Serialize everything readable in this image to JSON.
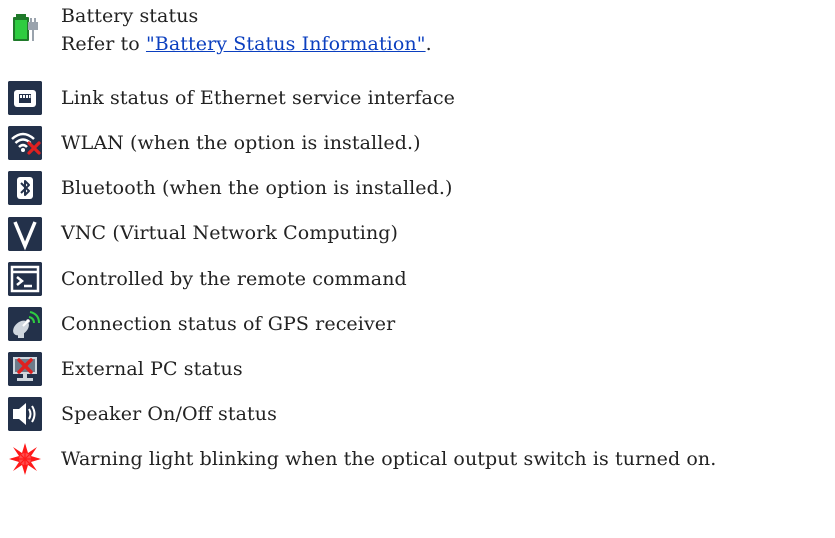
{
  "items": [
    {
      "icon": "battery-charging-icon",
      "label": "Battery status",
      "sub_prefix": "Refer to ",
      "link_text": "\"Battery Status Information\"",
      "sub_suffix": "."
    },
    {
      "icon": "ethernet-icon",
      "label": "Link status of Ethernet service interface"
    },
    {
      "icon": "wlan-disabled-icon",
      "label": "WLAN (when the option is installed.)"
    },
    {
      "icon": "bluetooth-icon",
      "label": "Bluetooth (when the option is installed.)"
    },
    {
      "icon": "vnc-icon",
      "label": "VNC (Virtual Network Computing)"
    },
    {
      "icon": "terminal-icon",
      "label": "Controlled by the remote command"
    },
    {
      "icon": "gps-satellite-icon",
      "label": "Connection status of GPS receiver"
    },
    {
      "icon": "external-pc-disconnected-icon",
      "label": "External PC status"
    },
    {
      "icon": "speaker-icon",
      "label": "Speaker On/Off status"
    },
    {
      "icon": "warning-light-icon",
      "label": "Warning light blinking when the optical output switch is turned on."
    }
  ],
  "colors": {
    "icon_background": "#23314a",
    "link": "#0b3fbf",
    "battery_green": "#2ecc40",
    "error_red": "#e02020",
    "warning_red": "#ff1a1a"
  }
}
